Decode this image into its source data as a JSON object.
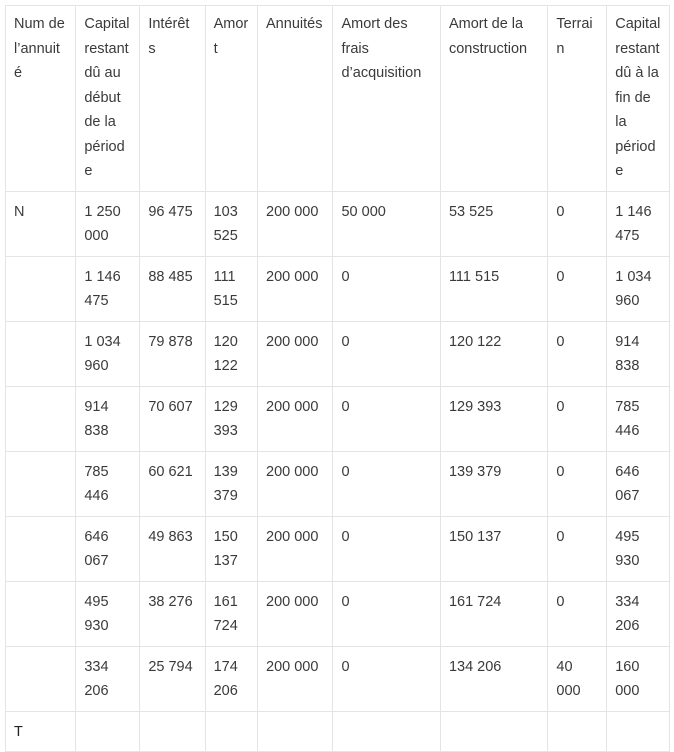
{
  "table": {
    "headers": [
      "Num de l’annuité",
      "Capital restant dû au début de la période",
      "Intérêts",
      "Amort",
      "Annuités",
      "Amort des frais d’acquisition",
      "Amort de la construction",
      "Terrain",
      "Capital restant dû à la fin de la période"
    ],
    "rows": [
      [
        "N",
        "1 250 000",
        "96 475",
        "103 525",
        "200 000",
        "50 000",
        "53 525",
        "0",
        "1 146 475"
      ],
      [
        "",
        "1 146 475",
        "88 485",
        "111 515",
        "200 000",
        "0",
        "111 515",
        "0",
        "1 034 960"
      ],
      [
        "",
        "1 034 960",
        "79 878",
        "120 122",
        "200 000",
        "0",
        "120 122",
        "0",
        "914 838"
      ],
      [
        "",
        "914 838",
        "70 607",
        "129 393",
        "200 000",
        "0",
        "129 393",
        "0",
        "785 446"
      ],
      [
        "",
        "785 446",
        "60 621",
        "139 379",
        "200 000",
        "0",
        "139 379",
        "0",
        "646 067"
      ],
      [
        "",
        "646 067",
        "49 863",
        "150 137",
        "200 000",
        "0",
        "150 137",
        "0",
        "495 930"
      ],
      [
        "",
        "495 930",
        "38 276",
        "161 724",
        "200 000",
        "0",
        "161 724",
        "0",
        "334 206"
      ],
      [
        "",
        "334 206",
        "25 794",
        "174 206",
        "200 000",
        "0",
        "134 206",
        "40 000",
        "160 000"
      ],
      [
        "T",
        "",
        "",
        "",
        "",
        "",
        "",
        "",
        ""
      ]
    ]
  }
}
